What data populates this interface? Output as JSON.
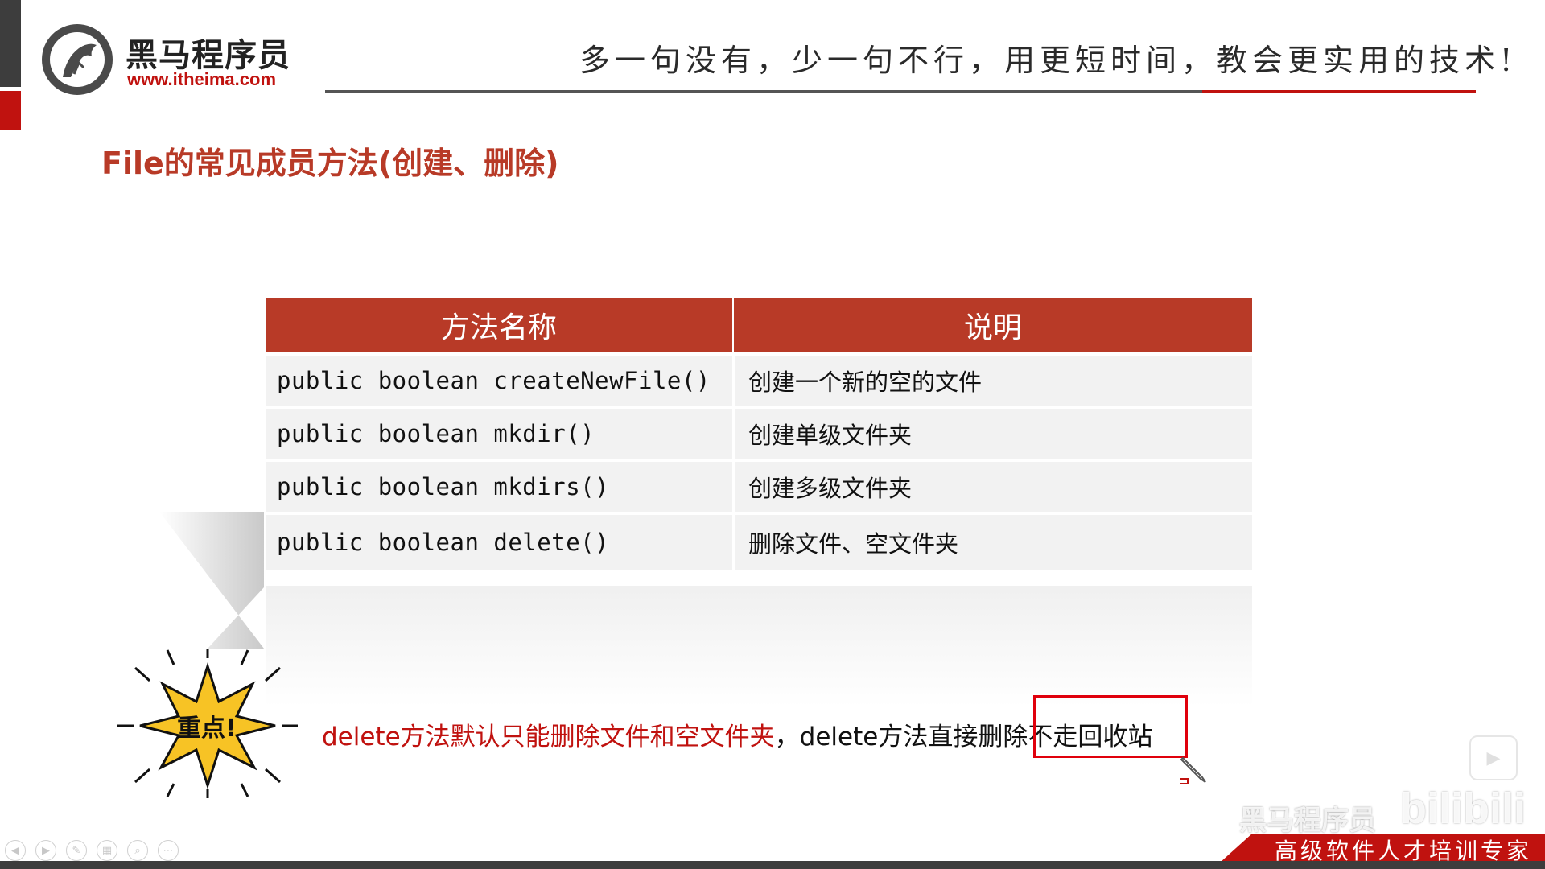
{
  "header": {
    "logo_name": "黑马程序员",
    "logo_url": "www.itheima.com",
    "slogan": "多一句没有，少一句不行，用更短时间，教会更实用的技术!"
  },
  "page_title": "File的常见成员方法(创建、删除)",
  "table": {
    "headers": [
      "方法名称",
      "说明"
    ],
    "rows": [
      {
        "method": "public boolean createNewFile()",
        "desc": "创建一个新的空的文件"
      },
      {
        "method": "public boolean mkdir()",
        "desc": "创建单级文件夹"
      },
      {
        "method": "public boolean mkdirs()",
        "desc": "创建多级文件夹"
      },
      {
        "method": "public boolean delete()",
        "desc": "删除文件、空文件夹"
      }
    ]
  },
  "burst_label": "重点!",
  "note": {
    "part1": "delete方法默认只能删除文件和空文件夹",
    "part2": "，delete方法直接删除",
    "part3": "不走回收站"
  },
  "footer": {
    "slogan": "高级软件人才培训专家",
    "watermark": "黑马程序员",
    "bili": "bilibili"
  },
  "colors": {
    "brand_red": "#c0120f",
    "header_red": "#b83a27",
    "highlight": "#e0000c"
  },
  "icons": [
    "logo-horse-icon",
    "pen-cursor-icon",
    "play-icon",
    "prev-icon",
    "next-icon",
    "pen-tool-icon",
    "slides-icon",
    "zoom-icon",
    "more-icon"
  ]
}
